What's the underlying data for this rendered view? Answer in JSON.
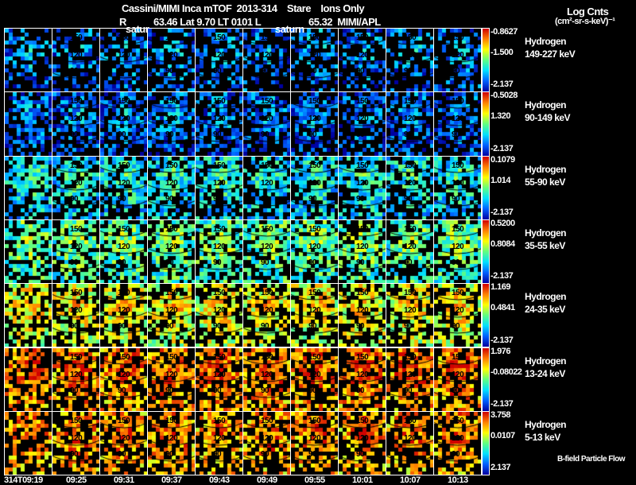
{
  "header": {
    "line1": "Cassini/MIMI Inca mTOF  2013-314    Stare    Ions Only",
    "line2_r": "R",
    "line2_rest": "63.46 Lat 9.70 LT 0101 L",
    "line2_l": "65.32  MIMI/APL",
    "saturn_label_1": "satur",
    "saturn_label_2": "saturn"
  },
  "units": {
    "line1": "Log Cnts",
    "line2": "(cm²-sr-s-keV)⁻¹"
  },
  "footer_note": "B-field Particle Flow",
  "chart_data": {
    "type": "heatmap",
    "time_labels": [
      "314T09:19",
      "09:25",
      "09:31",
      "09:37",
      "09:43",
      "09:49",
      "09:55",
      "10:01",
      "10:07",
      "10:13"
    ],
    "contour_labels": [
      "150",
      "120",
      "90"
    ],
    "colormap": [
      "#0000a0",
      "#0060ff",
      "#00e0ff",
      "#60ff80",
      "#ffff00",
      "#ff8000",
      "#d00000"
    ],
    "rows": [
      {
        "species": "Hydrogen",
        "energy": "149-227 keV",
        "max": "-0.8627",
        "mid": "-1.500",
        "min": "-2.137"
      },
      {
        "species": "Hydrogen",
        "energy": "90-149 keV",
        "max": "-0.5028",
        "mid": "1.320",
        "min": "-2.137"
      },
      {
        "species": "Hydrogen",
        "energy": "55-90 keV",
        "max": "0.1079",
        "mid": "1.014",
        "min": "-2.137"
      },
      {
        "species": "Hydrogen",
        "energy": "35-55 keV",
        "max": "0.5200",
        "mid": "0.8084",
        "min": "-2.137"
      },
      {
        "species": "Hydrogen",
        "energy": "24-35 keV",
        "max": "1.169",
        "mid": "0.4841",
        "min": "-2.137"
      },
      {
        "species": "Hydrogen",
        "energy": "13-24 keV",
        "max": "1.976",
        "mid": "-0.08022",
        "min": "-2.137"
      },
      {
        "species": "Hydrogen",
        "energy": "5-13 keV",
        "max": "3.758",
        "mid": "0.0107",
        "min": "2.137"
      }
    ]
  }
}
